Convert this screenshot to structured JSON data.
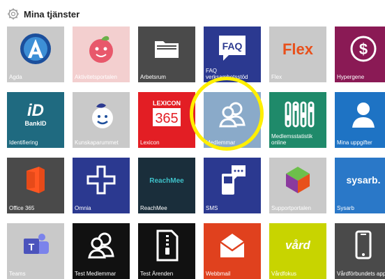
{
  "header": {
    "title": "Mina tjänster",
    "icon": "gear-icon"
  },
  "highlight": {
    "color": "#fff200",
    "target": "Medlemmar"
  },
  "tiles": [
    {
      "label": "Agda",
      "bg": "#c9c9c9",
      "icon": "agda-logo-icon"
    },
    {
      "label": "Aktivitetsportalen",
      "bg": "#f3cfcf",
      "icon": "apple-face-icon"
    },
    {
      "label": "Arbetsrum",
      "bg": "#4a4a4a",
      "icon": "folder-icon"
    },
    {
      "label": "FAQ verksamhetsstöd",
      "bg": "#2b3990",
      "icon": "faq-bubble-icon"
    },
    {
      "label": "Flex",
      "bg": "#c9c9c9",
      "icon": "flex-logo-icon"
    },
    {
      "label": "Hypergene",
      "bg": "#8a1a55",
      "icon": "dollar-circle-icon"
    },
    {
      "label": "Identifiering",
      "bg": "#1f6a80",
      "icon": "bankid-icon"
    },
    {
      "label": "Kunskaparummet",
      "bg": "#c9c9c9",
      "icon": "kunskap-face-icon"
    },
    {
      "label": "Lexicon",
      "bg": "#e31e24",
      "icon": "lexicon-365-icon"
    },
    {
      "label": "Medlemmar",
      "bg": "#8aaac9",
      "icon": "members-icon"
    },
    {
      "label": "Medlemsstatistik online",
      "bg": "#1f8a6a",
      "icon": "sliders-icon"
    },
    {
      "label": "Mina uppgifter",
      "bg": "#1e73c4",
      "icon": "person-icon"
    },
    {
      "label": "Office 365",
      "bg": "#4a4a4a",
      "icon": "office-icon"
    },
    {
      "label": "Omnia",
      "bg": "#2b3990",
      "icon": "omnia-cross-icon"
    },
    {
      "label": "ReachMee",
      "bg": "#1a2e3b",
      "icon": "reachmee-logo-icon"
    },
    {
      "label": "SMS",
      "bg": "#2b3990",
      "icon": "sms-phone-icon"
    },
    {
      "label": "Supportportalen",
      "bg": "#c9c9c9",
      "icon": "cube-icon"
    },
    {
      "label": "Sysarb",
      "bg": "#2a78c8",
      "icon": "sysarb-logo-icon"
    },
    {
      "label": "Teams",
      "bg": "#c9c9c9",
      "icon": "teams-icon"
    },
    {
      "label": "Test Medlemmar",
      "bg": "#111111",
      "icon": "members-outline-icon"
    },
    {
      "label": "Test Ärenden",
      "bg": "#111111",
      "icon": "zip-document-icon"
    },
    {
      "label": "Webbmail",
      "bg": "#e0411e",
      "icon": "mail-icon"
    },
    {
      "label": "Vårdfokus",
      "bg": "#c8d400",
      "icon": "vard-logo-icon"
    },
    {
      "label": "Vårdförbundets app",
      "bg": "#4a4a4a",
      "icon": "mobile-icon"
    }
  ],
  "logos": {
    "faq": "FAQ",
    "flex": "Flex",
    "bankid": "BankID",
    "lexicon": "LEXICON",
    "lexicon_num": "365",
    "reachmee": "ReachMee",
    "sysarb": "sysarb.",
    "vard": "vård",
    "teams": "T"
  }
}
